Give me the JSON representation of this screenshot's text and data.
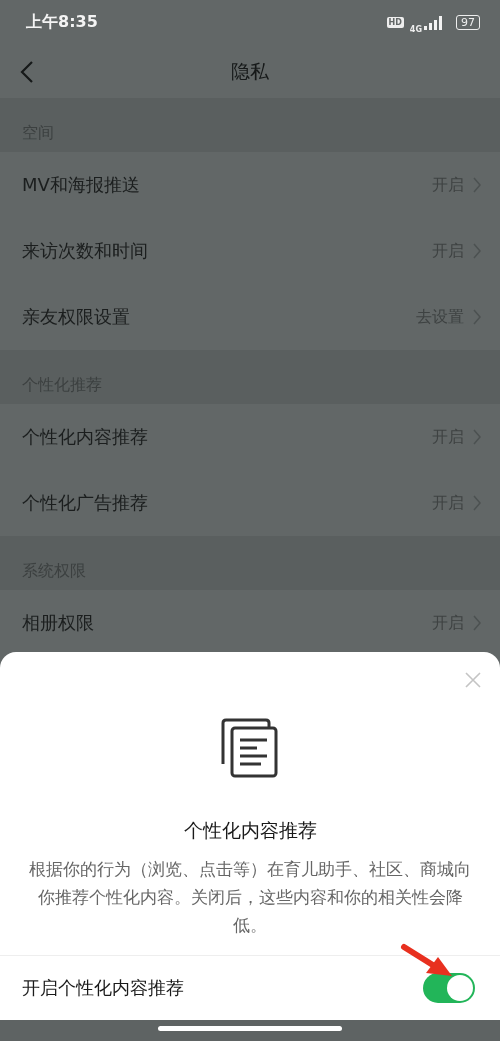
{
  "status_bar": {
    "time": "上午8:35",
    "hd": "HD",
    "network": "4G",
    "battery": "97"
  },
  "nav": {
    "title": "隐私"
  },
  "sections": [
    {
      "title": "空间",
      "rows": [
        {
          "label": "MV和海报推送",
          "value": "开启"
        },
        {
          "label": "来访次数和时间",
          "value": "开启"
        },
        {
          "label": "亲友权限设置",
          "value": "去设置"
        }
      ]
    },
    {
      "title": "个性化推荐",
      "rows": [
        {
          "label": "个性化内容推荐",
          "value": "开启"
        },
        {
          "label": "个性化广告推荐",
          "value": "开启"
        }
      ]
    },
    {
      "title": "系统权限",
      "rows": [
        {
          "label": "相册权限",
          "value": "开启"
        }
      ]
    }
  ],
  "sheet": {
    "title": "个性化内容推荐",
    "description": "根据你的行为（浏览、点击等）在育儿助手、社区、商城向你推荐个性化内容。关闭后，这些内容和你的相关性会降低。",
    "toggle": {
      "label": "开启个性化内容推荐",
      "on": true
    }
  }
}
